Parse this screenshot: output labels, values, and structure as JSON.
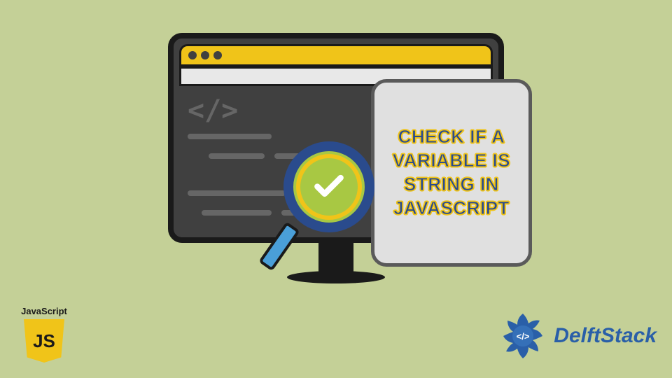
{
  "main_title": "CHECK IF A VARIABLE IS STRING IN JAVASCRIPT",
  "js_logo": {
    "label": "JavaScript",
    "badge": "JS"
  },
  "delft_logo": {
    "text": "DelftStack"
  },
  "colors": {
    "background": "#c4d097",
    "accent_yellow": "#f0c419",
    "accent_blue": "#2a4b8d",
    "accent_green": "#a8c843",
    "light_blue": "#4a9fd8"
  }
}
